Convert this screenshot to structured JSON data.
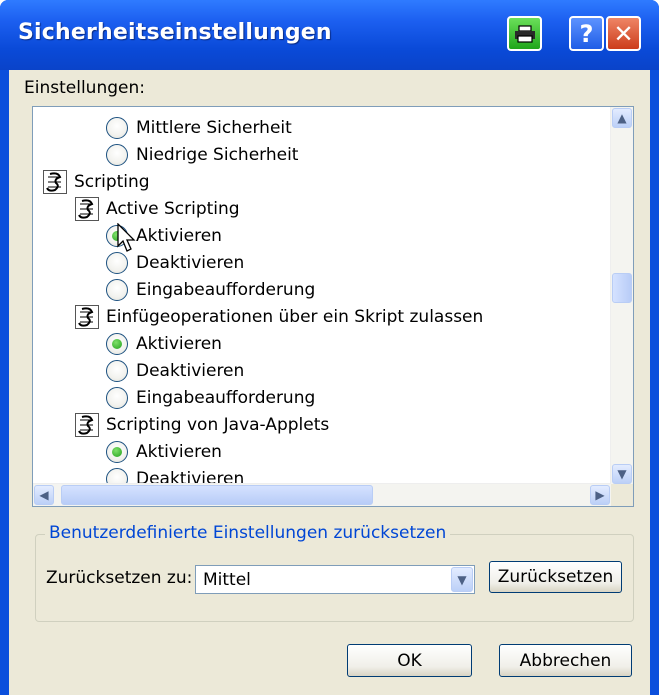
{
  "window": {
    "title": "Sicherheitseinstellungen"
  },
  "labels": {
    "settings": "Einstellungen:"
  },
  "list": {
    "items": [
      {
        "type": "radio",
        "label": "Mittlere Sicherheit",
        "checked": false
      },
      {
        "type": "radio",
        "label": "Niedrige Sicherheit",
        "checked": false
      },
      {
        "type": "category",
        "label": "Scripting"
      },
      {
        "type": "category",
        "label": "Active Scripting"
      },
      {
        "type": "radio",
        "label": "Aktivieren",
        "checked": true
      },
      {
        "type": "radio",
        "label": "Deaktivieren",
        "checked": false
      },
      {
        "type": "radio",
        "label": "Eingabeaufforderung",
        "checked": false
      },
      {
        "type": "category",
        "label": "Einfügeoperationen über ein Skript zulassen"
      },
      {
        "type": "radio",
        "label": "Aktivieren",
        "checked": true
      },
      {
        "type": "radio",
        "label": "Deaktivieren",
        "checked": false
      },
      {
        "type": "radio",
        "label": "Eingabeaufforderung",
        "checked": false
      },
      {
        "type": "category",
        "label": "Scripting von Java-Applets"
      },
      {
        "type": "radio",
        "label": "Aktivieren",
        "checked": true
      },
      {
        "type": "radio",
        "label": "Deaktivieren",
        "checked": false
      }
    ]
  },
  "reset_group": {
    "title": "Benutzerdefinierte Einstellungen zurücksetzen",
    "reset_to_label": "Zurücksetzen zu:",
    "reset_to_value": "Mittel",
    "reset_button": "Zurücksetzen"
  },
  "buttons": {
    "ok": "OK",
    "cancel": "Abbrechen"
  },
  "colors": {
    "titlebar": "#0a4ad8",
    "face": "#ece9d8",
    "accent": "#0046d5"
  }
}
